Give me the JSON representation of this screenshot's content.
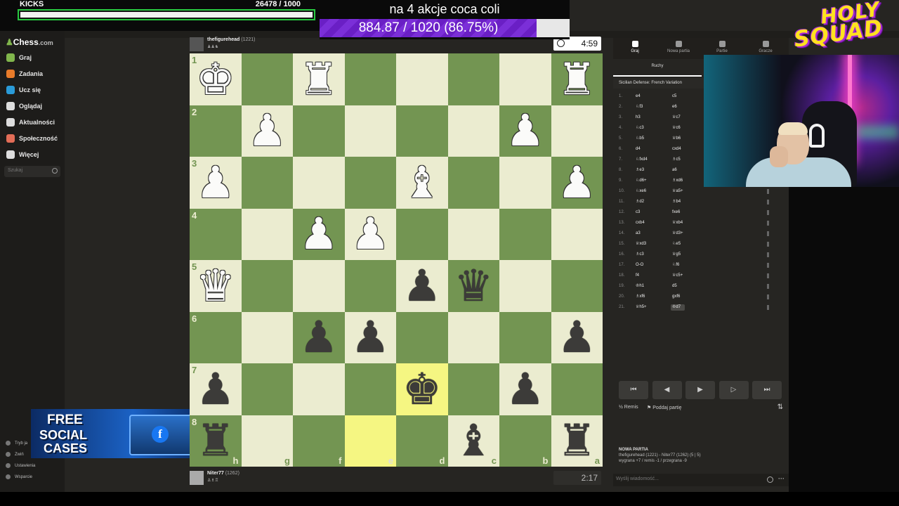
{
  "overlay": {
    "kicks_label": "KICKS",
    "kicks_count": "26478  / 1000",
    "kicks_progress": 0.99,
    "goal_title": "na 4 akcje coca coli",
    "goal_value": "884.87 / 1020 (86.75%)",
    "goal_progress": 0.8675,
    "brand_top": "HOLY",
    "brand_bottom": "SQUAD",
    "promo_line1": "FREE",
    "promo_line2": "SOCIAL",
    "promo_line3": "CASES"
  },
  "sidebar": {
    "logo": "Chess",
    "logo_suffix": ".com",
    "items": [
      {
        "label": "Graj",
        "color": "#81b64c"
      },
      {
        "label": "Zadania",
        "color": "#e87b2a"
      },
      {
        "label": "Ucz się",
        "color": "#2a9bd8"
      },
      {
        "label": "Oglądaj",
        "color": "#dddddd"
      },
      {
        "label": "Aktualności",
        "color": "#dddddd"
      },
      {
        "label": "Społeczność",
        "color": "#e36d57"
      },
      {
        "label": "Więcej",
        "color": "#dddddd"
      }
    ],
    "search_placeholder": "Szukaj",
    "footer": [
      "Tryb ja",
      "Zwiń",
      "Ustawienia",
      "Wsparcie"
    ]
  },
  "top_player": {
    "name": "thefigurehead",
    "rating": "(1221)",
    "clock": "4:59"
  },
  "bottom_player": {
    "name": "Niter77",
    "rating": "(1262)",
    "clock": "2:17"
  },
  "board": {
    "light_color": "#ebecd0",
    "dark_color": "#739552",
    "rank_labels": [
      "1",
      "2",
      "3",
      "4",
      "5",
      "6",
      "7",
      "8"
    ],
    "file_labels": [
      "h",
      "g",
      "f",
      "e",
      "d",
      "c",
      "b",
      "a"
    ],
    "highlights": [
      "e8",
      "d7"
    ],
    "rows": [
      [
        "wK",
        "",
        "wR",
        "",
        "",
        "",
        "",
        "wR"
      ],
      [
        "",
        "wP",
        "",
        "",
        "",
        "",
        "wP",
        ""
      ],
      [
        "wP",
        "",
        "",
        "",
        "wB",
        "",
        "",
        "wP"
      ],
      [
        "",
        "",
        "wP",
        "wP",
        "",
        "",
        "",
        ""
      ],
      [
        "wQ",
        "",
        "",
        "",
        "bP",
        "bQ",
        "",
        ""
      ],
      [
        "",
        "",
        "bP",
        "bP",
        "",
        "",
        "",
        "bP"
      ],
      [
        "bP",
        "",
        "",
        "",
        "bK",
        "",
        "bP",
        ""
      ],
      [
        "bR",
        "",
        "",
        "",
        "",
        "bB",
        "",
        "bR"
      ]
    ]
  },
  "panel": {
    "tabs": [
      "Graj",
      "Nowa partia",
      "Partie",
      "Gracze"
    ],
    "subtab": "Ruchy",
    "opening": "Sicilian Defense: French Variation",
    "moves": [
      {
        "n": "1.",
        "w": "e4",
        "b": "c5"
      },
      {
        "n": "2.",
        "w": "♘f3",
        "b": "e6"
      },
      {
        "n": "3.",
        "w": "h3",
        "b": "♕c7"
      },
      {
        "n": "4.",
        "w": "♘c3",
        "b": "♕c6"
      },
      {
        "n": "5.",
        "w": "♘b5",
        "b": "♕b6"
      },
      {
        "n": "6.",
        "w": "d4",
        "b": "cxd4"
      },
      {
        "n": "7.",
        "w": "♘fxd4",
        "b": "♗c5"
      },
      {
        "n": "8.",
        "w": "♗e3",
        "b": "a6"
      },
      {
        "n": "9.",
        "w": "♘d6+",
        "b": "♗xd6"
      },
      {
        "n": "10.",
        "w": "♘xe6",
        "b": "♕a5+"
      },
      {
        "n": "11.",
        "w": "♗d2",
        "b": "♗b4"
      },
      {
        "n": "12.",
        "w": "c3",
        "b": "fxe6"
      },
      {
        "n": "13.",
        "w": "cxb4",
        "b": "♕xb4"
      },
      {
        "n": "14.",
        "w": "a3",
        "b": "♕d3+"
      },
      {
        "n": "15.",
        "w": "♕xd3",
        "b": "♘e5"
      },
      {
        "n": "16.",
        "w": "♗c3",
        "b": "♕g5"
      },
      {
        "n": "17.",
        "w": "O-O",
        "b": "♘f6"
      },
      {
        "n": "18.",
        "w": "f4",
        "b": "♕c5+"
      },
      {
        "n": "19.",
        "w": "♔h1",
        "b": "d5"
      },
      {
        "n": "20.",
        "w": "♗xf6",
        "b": "gxf6"
      },
      {
        "n": "21.",
        "w": "♕h5+",
        "b": "♔d7"
      }
    ],
    "controls": [
      "⏮",
      "◀",
      "▶",
      "▷",
      "⏭"
    ],
    "draw_label": "Remis",
    "resign_label": "Poddaj partię",
    "game_header": "NOWA PARTIA",
    "game_line1": "thefigurehead (1221) - Niter77 (1262) (5 | 5)",
    "game_line2": "wygrana +7 / remis -1 / przegrana -9",
    "chat_placeholder": "Wyślij wiadomość..."
  }
}
